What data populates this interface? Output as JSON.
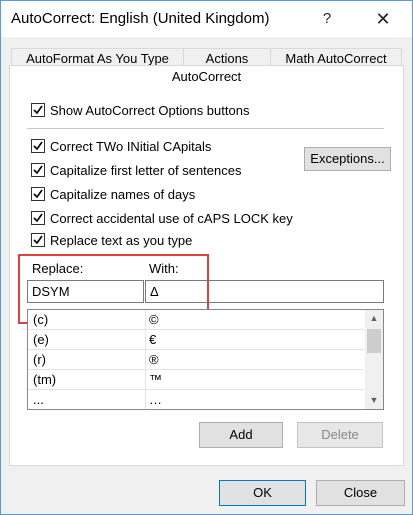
{
  "window": {
    "title": "AutoCorrect: English (United Kingdom)"
  },
  "titlebar": {
    "help_glyph": "?",
    "close_glyph": "✕"
  },
  "tabs": [
    {
      "label": "AutoFormat As You Type"
    },
    {
      "label": "Actions"
    },
    {
      "label": "Math AutoCorrect"
    },
    {
      "label": "AutoCorrect"
    }
  ],
  "options": {
    "show_buttons": {
      "label": "Show AutoCorrect Options buttons",
      "checked": true
    },
    "two_initials": {
      "label": "Correct TWo INitial CApitals",
      "checked": true
    },
    "first_letter": {
      "label": "Capitalize first letter of sentences",
      "checked": true
    },
    "names_of_days": {
      "label": "Capitalize names of days",
      "checked": true
    },
    "caps_lock": {
      "label": "Correct accidental use of cAPS LOCK key",
      "checked": true
    },
    "replace_text": {
      "label": "Replace text as you type",
      "checked": true
    }
  },
  "exceptions_button": "Exceptions...",
  "replace_label": "Replace:",
  "with_label": "With:",
  "replace_value": "DSYM",
  "with_value": "Δ",
  "entries": [
    {
      "replace": "(c)",
      "with": "©"
    },
    {
      "replace": "(e)",
      "with": "€"
    },
    {
      "replace": "(r)",
      "with": "®"
    },
    {
      "replace": "(tm)",
      "with": "™"
    },
    {
      "replace": "...",
      "with": "…"
    }
  ],
  "add_button": "Add",
  "delete_button": "Delete",
  "ok_button": "OK",
  "close_button": "Close",
  "colors": {
    "highlight": "#e04040",
    "accent": "#0078d7"
  }
}
